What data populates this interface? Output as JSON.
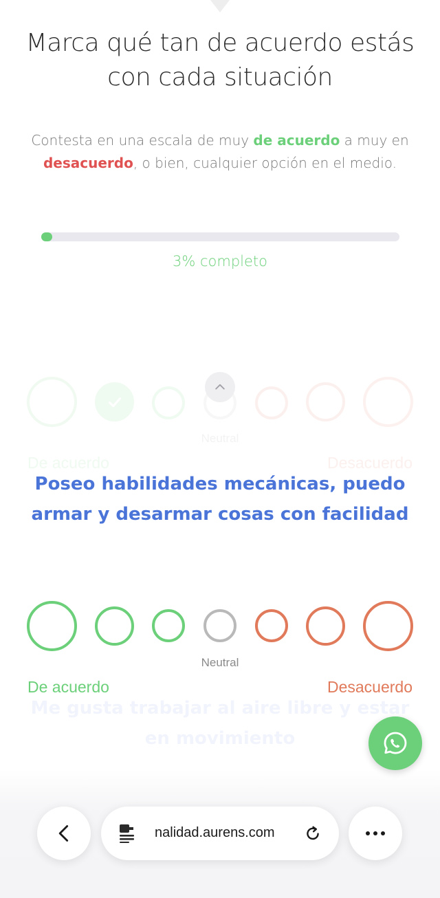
{
  "header": {
    "title": "Marca qué tan de acuerdo estás con cada situación",
    "subtitle_pre": "Contesta en una escala de muy ",
    "subtitle_agree": "de acuerdo",
    "subtitle_mid": " a muy en ",
    "subtitle_disagree": "desacuerdo",
    "subtitle_post": ", o bien, cualquier opción en el medio."
  },
  "progress": {
    "percent": 3,
    "label": "3% completo"
  },
  "scale_labels": {
    "agree": "De acuerdo",
    "neutral": "Neutral",
    "disagree": "Desacuerdo"
  },
  "previous_question": {
    "selected_index": 1
  },
  "current_question": {
    "text": "Poseo habilidades mecánicas, puedo armar y desarmar cosas con facilidad"
  },
  "next_question": {
    "text": "Me gusta trabajar al aire libre y estar en movimiento"
  },
  "browser": {
    "url": "nalidad.aurens.com"
  },
  "icons": {
    "whatsapp": "whatsapp-icon",
    "back": "chevron-left-icon",
    "reader": "reader-mode-icon",
    "reload": "reload-icon",
    "more": "more-dots-icon",
    "collapse": "chevron-up-icon",
    "check": "check-icon"
  },
  "colors": {
    "agree": "#6bd079",
    "disagree": "#e07a5a",
    "neutral": "#b9b9b9",
    "question": "#4a74d8",
    "desacuerdo_text": "#e05252"
  }
}
